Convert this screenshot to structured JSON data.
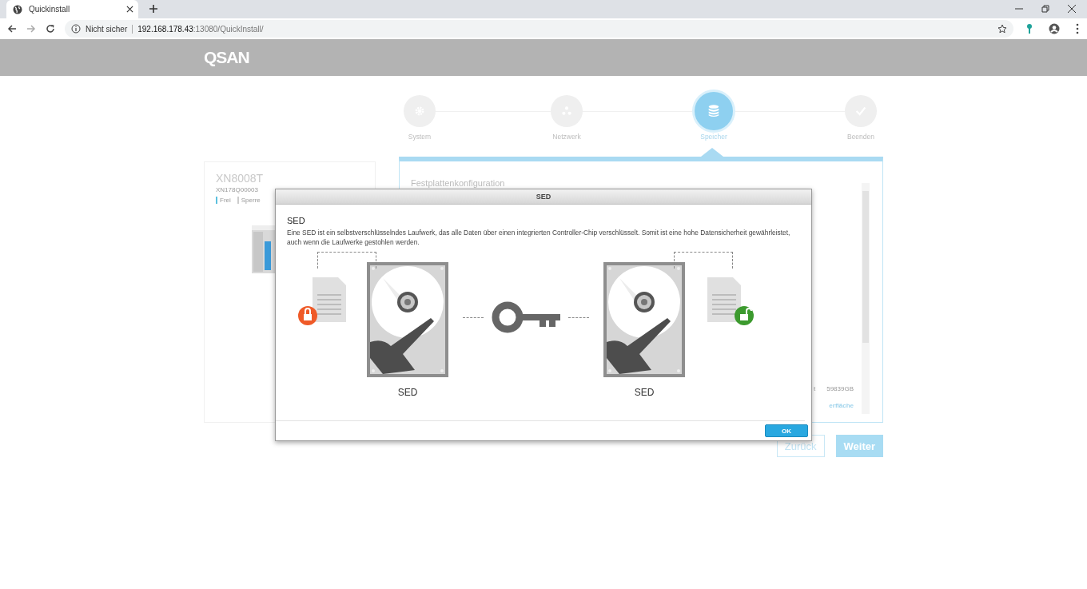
{
  "browser": {
    "tab_title": "Quickinstall",
    "security": "Nicht sicher",
    "url_host": "192.168.178.43",
    "url_rest": ":13080/QuickInstall/"
  },
  "header": {
    "logo": "QSAN"
  },
  "steps": [
    {
      "label": "System",
      "kind": "gear",
      "selected": false
    },
    {
      "label": "Netzwerk",
      "kind": "network",
      "selected": false
    },
    {
      "label": "Speicher",
      "kind": "storage",
      "selected": true
    },
    {
      "label": "Beenden",
      "kind": "check",
      "selected": false
    }
  ],
  "device": {
    "name": "XN8008T",
    "serial": "XN178Q00003",
    "legend": [
      {
        "label": "Frei",
        "color": "#5bc0de"
      },
      {
        "label": "Sperre",
        "color": "#cccccc"
      }
    ]
  },
  "panel": {
    "title": "Festplattenkonfiguration",
    "capacity_label": "t",
    "capacity": "59839GB",
    "link": "erfläche"
  },
  "dialog": {
    "title": "SED",
    "heading": "SED",
    "text": "Eine SED ist ein selbstverschlüsselndes Laufwerk, das alle Daten über einen integrierten Controller-Chip verschlüsselt. Somit ist eine hohe Datensicherheit gewährleistet, auch wenn die Laufwerke gestohlen werden.",
    "drives": [
      "SED",
      "SED"
    ],
    "ok": "OK"
  },
  "buttons": [
    {
      "label": "Zurück",
      "kind": "outline"
    },
    {
      "label": "Weiter",
      "kind": "primary"
    }
  ]
}
